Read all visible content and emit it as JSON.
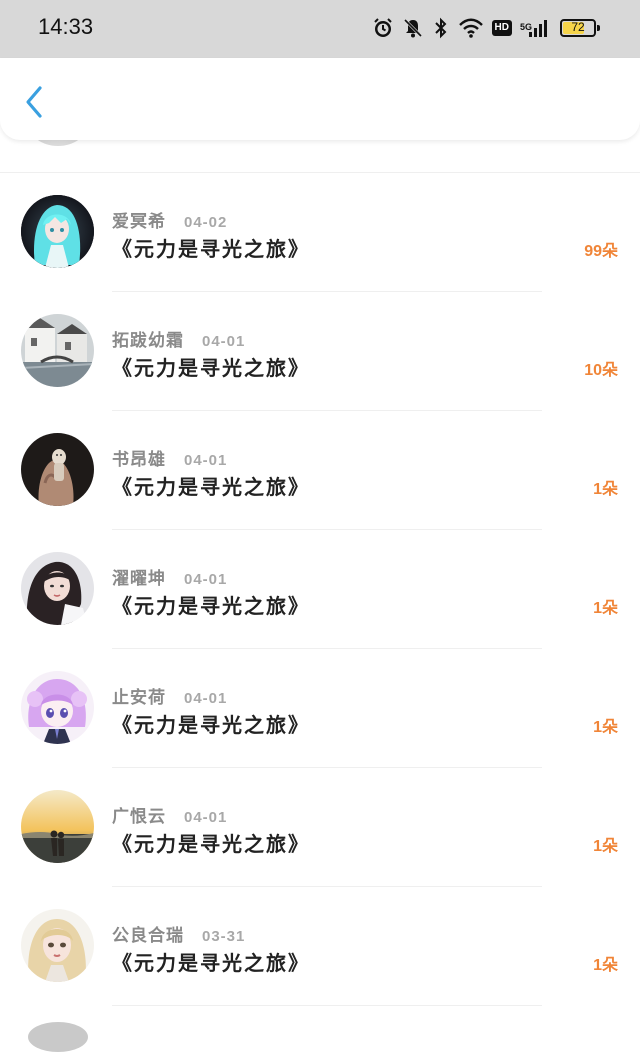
{
  "status_bar": {
    "time": "14:33",
    "battery": "72",
    "battery_level": 72,
    "network": "5G",
    "hd": "HD",
    "icons": [
      "alarm-icon",
      "mute-icon",
      "bluetooth-icon",
      "wifi-icon",
      "hd-icon",
      "signal-icon",
      "battery-icon"
    ]
  },
  "header": {
    "back_icon": "chevron-left-icon",
    "accent_color": "#3aa0e0"
  },
  "list": {
    "items": [
      {
        "name": "爱冥希",
        "date": "04-02",
        "title": "《元力是寻光之旅》",
        "count": "99朵",
        "avatar": "anime-cyan-hair"
      },
      {
        "name": "拓跋幼霜",
        "date": "04-01",
        "title": "《元力是寻光之旅》",
        "count": "10朵",
        "avatar": "white-buildings"
      },
      {
        "name": "书昂雄",
        "date": "04-01",
        "title": "《元力是寻光之旅》",
        "count": "1朵",
        "avatar": "hand-figure"
      },
      {
        "name": "濯曜坤",
        "date": "04-01",
        "title": "《元力是寻光之旅》",
        "count": "1朵",
        "avatar": "girl-portrait"
      },
      {
        "name": "止安荷",
        "date": "04-01",
        "title": "《元力是寻光之旅》",
        "count": "1朵",
        "avatar": "anime-purple-hair"
      },
      {
        "name": "广恨云",
        "date": "04-01",
        "title": "《元力是寻光之旅》",
        "count": "1朵",
        "avatar": "sunset-couple"
      },
      {
        "name": "公良合瑞",
        "date": "03-31",
        "title": "《元力是寻光之旅》",
        "count": "1朵",
        "avatar": "doll-portrait"
      }
    ]
  },
  "colors": {
    "count": "#f08538",
    "name": "#8a8a8a",
    "title": "#222222",
    "status_bg": "#d8d8d8"
  }
}
